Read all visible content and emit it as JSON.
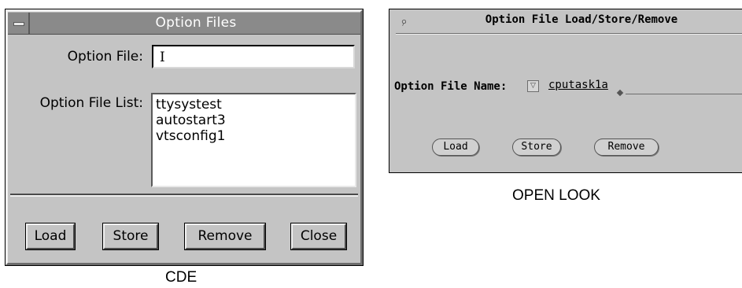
{
  "cde": {
    "title": "Option Files",
    "option_file_label": "Option File:",
    "option_file_value": "I",
    "option_file_list_label": "Option File List:",
    "option_file_list": [
      "ttysystest",
      "autostart3",
      "vtsconfig1"
    ],
    "buttons": {
      "load": "Load",
      "store": "Store",
      "remove": "Remove",
      "close": "Close"
    },
    "caption": "CDE"
  },
  "openlook": {
    "title": "Option File Load/Store/Remove",
    "option_file_name_label": "Option File Name:",
    "option_file_name_value": "cputask1a",
    "menu_button_glyph": "▽",
    "buttons": {
      "load": "Load",
      "store": "Store",
      "remove": "Remove"
    },
    "caption": "OPEN LOOK"
  },
  "icons": {
    "cde_window_menu": "window-menu-icon",
    "ol_pushpin": "pushpin-icon",
    "ol_abbrev_menu": "abbreviated-menu-button-icon"
  }
}
